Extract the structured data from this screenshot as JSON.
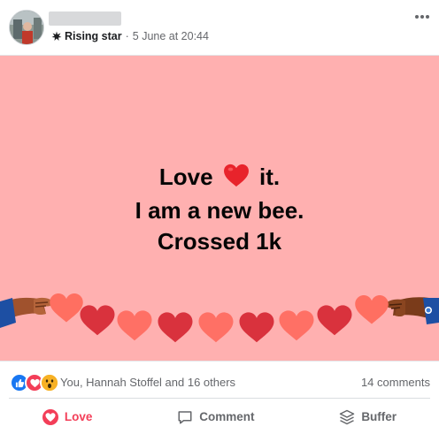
{
  "post": {
    "author_badge": "Rising star",
    "timestamp": "5 June at 20:44",
    "more_icon": "ellipsis-icon",
    "separator": "·"
  },
  "media": {
    "background_color": "#ffb0b0",
    "line1_before": "Love",
    "line1_after": "it.",
    "line2": "I am a new bee.",
    "line3": "Crossed 1k"
  },
  "stats": {
    "reaction_icons": [
      "like-icon",
      "love-icon",
      "wow-icon"
    ],
    "reactions_text": "You, Hannah Stoffel and 16 others",
    "comments_text": "14 comments"
  },
  "actions": {
    "love_label": "Love",
    "comment_label": "Comment",
    "buffer_label": "Buffer"
  },
  "colors": {
    "love": "#f33e58",
    "like": "#1877f2",
    "wow": "#f7b125",
    "text_secondary": "#65676b"
  }
}
